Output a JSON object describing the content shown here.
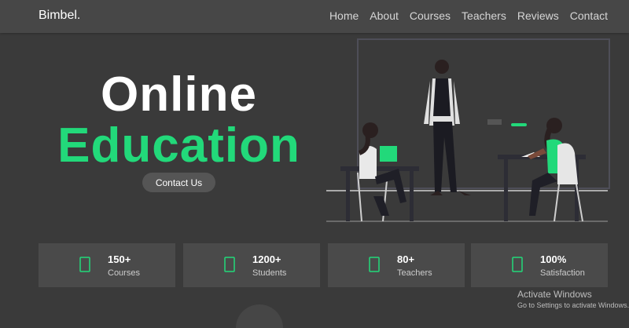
{
  "nav": {
    "brand": "Bimbel.",
    "links": [
      {
        "label": "Home"
      },
      {
        "label": "About"
      },
      {
        "label": "Courses"
      },
      {
        "label": "Teachers"
      },
      {
        "label": "Reviews"
      },
      {
        "label": "Contact"
      }
    ]
  },
  "hero": {
    "title_line1": "Online",
    "title_line2": "Education",
    "cta_label": "Contact Us",
    "accent_color": "#22d97a"
  },
  "stats": [
    {
      "value": "150+",
      "label": "Courses",
      "icon": "tablet-icon"
    },
    {
      "value": "1200+",
      "label": "Students",
      "icon": "tablet-icon"
    },
    {
      "value": "80+",
      "label": "Teachers",
      "icon": "tablet-icon"
    },
    {
      "value": "100%",
      "label": "Satisfaction",
      "icon": "tablet-icon"
    }
  ],
  "watermark": {
    "title": "Activate Windows",
    "subtitle": "Go to Settings to activate Windows."
  }
}
